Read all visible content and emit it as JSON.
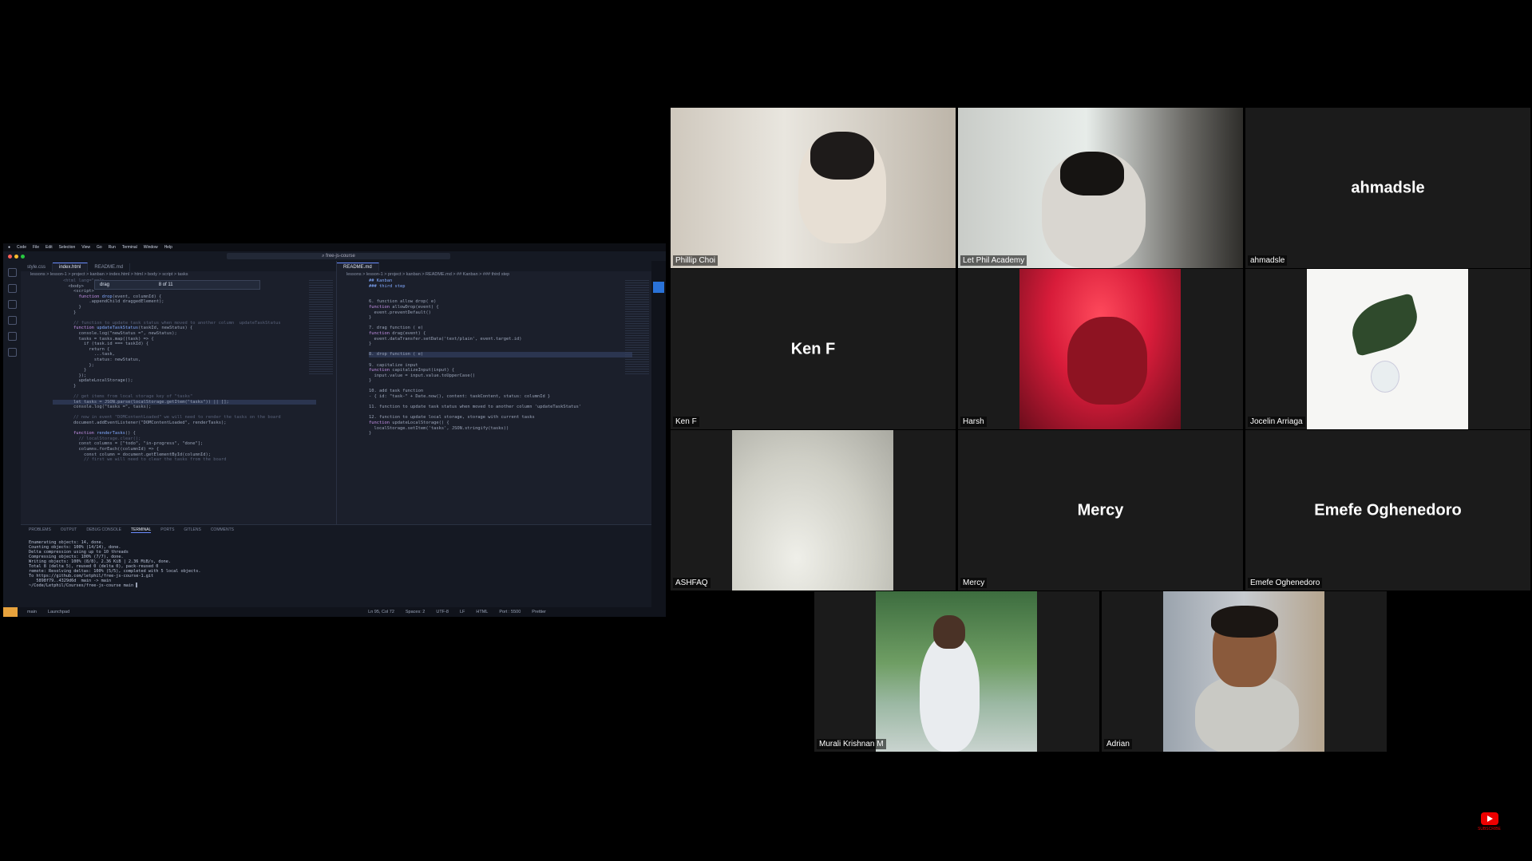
{
  "screen_share": {
    "mac_menu": [
      "Code",
      "File",
      "Edit",
      "Selection",
      "View",
      "Go",
      "Run",
      "Terminal",
      "Window",
      "Help"
    ],
    "window_search": "free-js-course",
    "left_tabs": [
      "style.css",
      "index.html",
      "README.md"
    ],
    "right_tabs": [
      "README.md"
    ],
    "left_breadcrumb": "lessons > lesson-1 > project > kanban > index.html > html > body > script > tasks",
    "right_breadcrumb": "lessons > lesson-1 > project > kanban > README.md > ## Kanban > ### third step",
    "find_query": "drag",
    "find_count": "8 of 11",
    "panel_tabs": [
      "PROBLEMS",
      "OUTPUT",
      "DEBUG CONSOLE",
      "TERMINAL",
      "PORTS",
      "GITLENS",
      "COMMENTS"
    ],
    "status_items": [
      "main",
      "Launchpad",
      "Ln 95, Col 72",
      "Spaces: 2",
      "UTF-8",
      "LF",
      "HTML",
      "Port : 5500",
      "Prettier"
    ],
    "terminal_prompt": "~/Code/Letphil/Courses/free-js-course main"
  },
  "participants": [
    {
      "label": "Phillip Choi",
      "display": ""
    },
    {
      "label": "Let Phil Academy",
      "display": ""
    },
    {
      "label": "ahmadsle",
      "display": "ahmadsle"
    },
    {
      "label": "Ken F",
      "display": "Ken F"
    },
    {
      "label": "Harsh",
      "display": ""
    },
    {
      "label": "Jocelin Arriaga",
      "display": ""
    },
    {
      "label": "ASHFAQ",
      "display": ""
    },
    {
      "label": "Mercy",
      "display": "Mercy"
    },
    {
      "label": "Emefe Oghenedoro",
      "display": "Emefe Oghenedoro"
    },
    {
      "label": "Murali Krishnan M",
      "display": ""
    },
    {
      "label": "Adrian",
      "display": ""
    }
  ],
  "youtube_badge": "SUBSCRIBE",
  "colors": {
    "background": "#000000",
    "tile": "#1b1b1b",
    "youtube_red": "#ee0000"
  }
}
